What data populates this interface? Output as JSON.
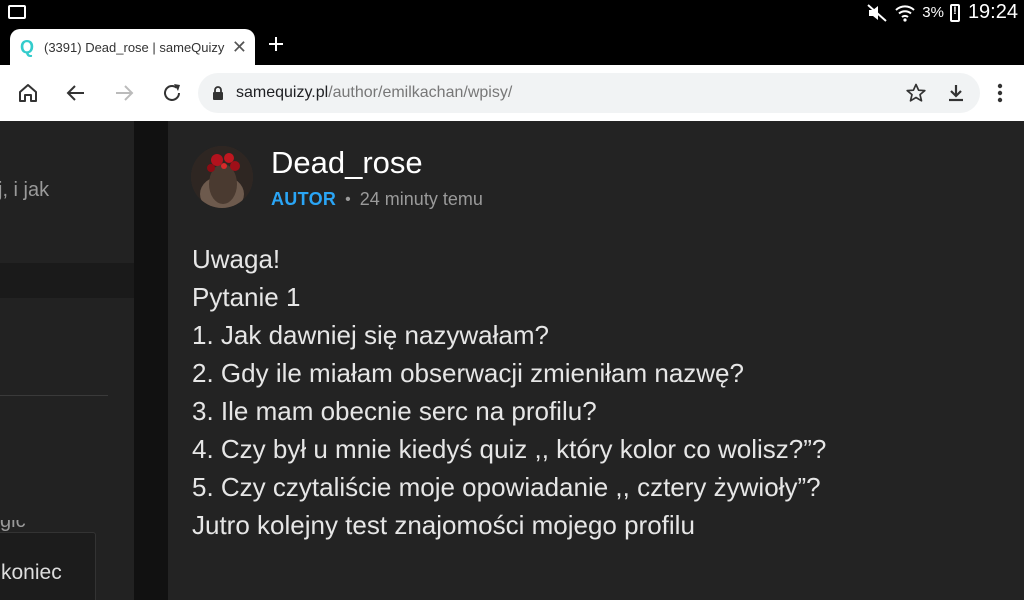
{
  "status_bar": {
    "left_icon": "gallery-icon",
    "icons": [
      "mute-icon",
      "wifi-icon"
    ],
    "battery": "3%",
    "time": "19:24"
  },
  "tab": {
    "favicon": "Q",
    "title": "(3391) Dead_rose | sameQuizy",
    "close_icon": "close-icon",
    "new_tab_icon": "plus-icon"
  },
  "toolbar": {
    "url_host": "samequizy.pl",
    "url_path": "/author/emilkachan/wpisy/",
    "icons": [
      "home-icon",
      "back-icon",
      "forward-icon",
      "reload-icon",
      "lock-icon",
      "star-icon",
      "download-icon",
      "more-vert-icon"
    ]
  },
  "sidebar": {
    "snippet": "j, i jak",
    "partial_text": "gic",
    "popup_text": "koniec"
  },
  "post": {
    "author": "Dead_rose",
    "role": "AUTOR",
    "separator": "•",
    "time": "24 minuty temu",
    "lines": [
      "Uwaga!",
      "Pytanie 1",
      "1. Jak dawniej się nazywałam?",
      "2. Gdy ile miałam obserwacji zmieniłam nazwę?",
      "3. Ile mam obecnie serc na profilu?",
      "4. Czy był u mnie kiedyś quiz ,, który kolor co wolisz?”?",
      "5. Czy czytaliście moje opowiadanie ,, cztery żywioły”?",
      "Jutro kolejny test znajomości mojego profilu"
    ]
  },
  "colors": {
    "accent": "#2aa5f5",
    "page_bg": "#161616",
    "card_bg": "#232323"
  }
}
